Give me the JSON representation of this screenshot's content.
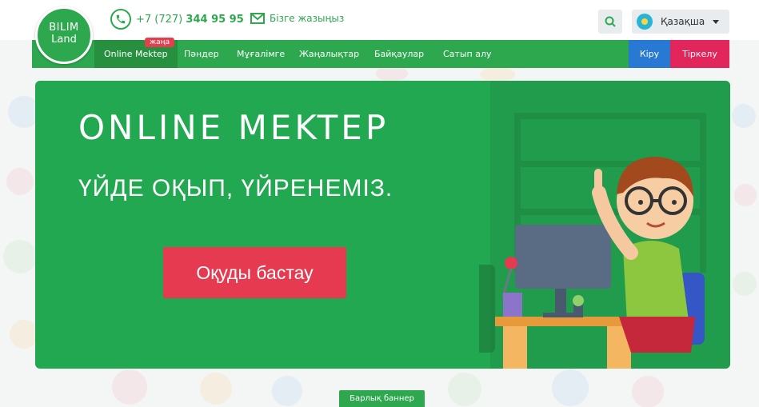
{
  "header": {
    "logo_line1": "BILIM",
    "logo_line2": "Land",
    "phone_prefix": "+7 (727)",
    "phone_number": "344 95 95",
    "contact_label": "Бізге жазыңыз",
    "language_label": "Қазақша"
  },
  "nav": {
    "items": [
      {
        "label": "Online Mektep"
      },
      {
        "label": "Пәндер"
      },
      {
        "label": "Мұғалімге"
      },
      {
        "label": "Жаңалықтар"
      },
      {
        "label": "Байқаулар"
      },
      {
        "label": "Сатып алу"
      }
    ],
    "new_badge": "жаңа",
    "login_label": "Кіру",
    "register_label": "Тіркелу"
  },
  "banner": {
    "title": "ONLINE MEKTEP",
    "subtitle": "ҮЙДЕ ОҚЫП, ҮЙРЕНЕМІЗ.",
    "cta_label": "Оқуды бастау"
  },
  "footer": {
    "all_banners_label": "Барлық баннер"
  },
  "colors": {
    "brand_green": "#2ea84f",
    "banner_green": "#23a852",
    "cta_red": "#e63a50",
    "login_blue": "#2879d4",
    "register_pink": "#e2265c"
  },
  "icons": [
    "phone-icon",
    "mail-icon",
    "search-icon",
    "kazakhstan-flag-icon",
    "chevron-down-icon"
  ]
}
